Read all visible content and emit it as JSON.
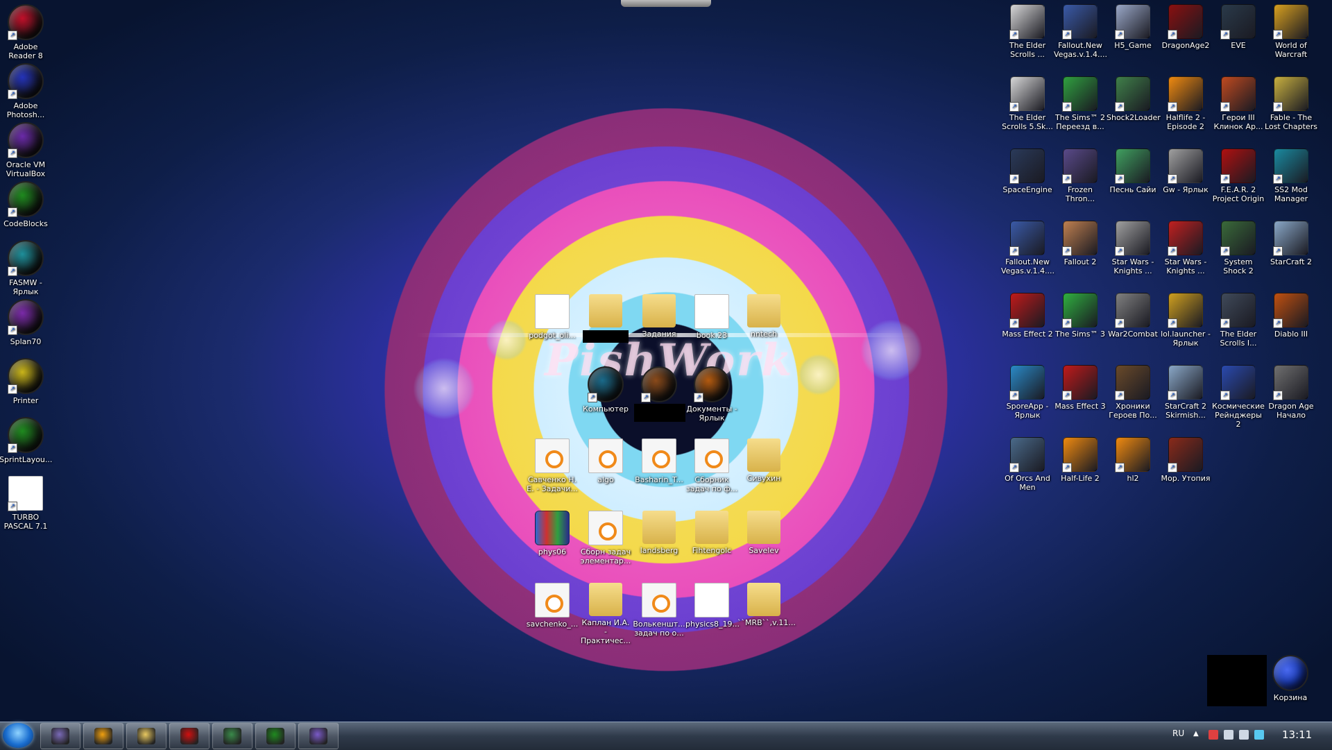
{
  "desktop": {
    "wallpaper_text": "PishWork",
    "left_column": [
      {
        "label": "Adobe Reader 8",
        "icon": "adobe-reader-orb-icon",
        "color": "#c0102a"
      },
      {
        "label": "Adobe Photosh...",
        "icon": "photoshop-orb-icon",
        "color": "#2433b8"
      },
      {
        "label": "Oracle VM VirtualBox",
        "icon": "virtualbox-orb-icon",
        "color": "#6a2aa8"
      },
      {
        "label": "CodeBlocks",
        "icon": "codeblocks-orb-icon",
        "color": "#1f8a1f"
      },
      {
        "label": "FASMW - Ярлык",
        "icon": "fasmw-orb-icon",
        "color": "#1e8f9a"
      },
      {
        "label": "Splan70",
        "icon": "splan-orb-icon",
        "color": "#7a2aa8"
      },
      {
        "label": "Printer",
        "icon": "printer-orb-icon",
        "color": "#c9b51a"
      },
      {
        "label": "SprintLayou...",
        "icon": "sprintlayout-orb-icon",
        "color": "#1f8a1f"
      },
      {
        "label": "TURBO PASCAL 7.1",
        "icon": "turbo-pascal-file-icon",
        "color": "#ffffff"
      }
    ],
    "center_icons": [
      {
        "label": "podgot_oli...",
        "type": "doc"
      },
      {
        "label": "",
        "type": "folder"
      },
      {
        "label": "Задания",
        "type": "folder"
      },
      {
        "label": "book.23",
        "type": "doc"
      },
      {
        "label": "nntech",
        "type": "folder"
      },
      {
        "label": "Компьютер",
        "type": "orb",
        "color": "#1a6a8a"
      },
      {
        "label": "",
        "type": "orb",
        "color": "#8a4a1a"
      },
      {
        "label": "Документы - Ярлык",
        "type": "orb",
        "color": "#b35a10"
      },
      {
        "label": "Савченко Н. Е. - Задачи...",
        "type": "djvu"
      },
      {
        "label": "algo",
        "type": "djvu"
      },
      {
        "label": "Basharin_T...",
        "type": "djvu"
      },
      {
        "label": "Сборник задач по ф...",
        "type": "djvu"
      },
      {
        "label": "Сивухин",
        "type": "folder"
      },
      {
        "label": "phys06",
        "type": "rar"
      },
      {
        "label": "Сборн задач элементар...",
        "type": "djvu"
      },
      {
        "label": "landsberg",
        "type": "folder"
      },
      {
        "label": "Fihtengolc",
        "type": "folder"
      },
      {
        "label": "Savelev",
        "type": "folder"
      },
      {
        "label": "savchenko_...",
        "type": "djvu"
      },
      {
        "label": "Каплан И.А. - Практичес...",
        "type": "folder"
      },
      {
        "label": "Волькеншт... задач по о...",
        "type": "djvu"
      },
      {
        "label": "physics8_19...",
        "type": "doc"
      },
      {
        "label": "``MRB``,v.11...",
        "type": "folder"
      }
    ],
    "right_grid": [
      {
        "label": "The Elder Scrolls ...",
        "color": "#d8d8d8"
      },
      {
        "label": "Fallout.New Vegas.v.1.4....",
        "color": "#3a5aa8"
      },
      {
        "label": "H5_Game",
        "color": "#9aa8c8"
      },
      {
        "label": "DragonAge2",
        "color": "#8a1010"
      },
      {
        "label": "EVE",
        "color": "#2a3a4a"
      },
      {
        "label": "World of Warcraft",
        "color": "#d8a020"
      },
      {
        "label": "The Elder Scrolls 5.Sk...",
        "color": "#d8d8d8"
      },
      {
        "label": "The Sims™ 2 Переезд в...",
        "color": "#30a040"
      },
      {
        "label": "Shock2Loader",
        "color": "#40804a"
      },
      {
        "label": "Halflife 2 - Episode 2",
        "color": "#f08a10"
      },
      {
        "label": "Герои III Клинок Ар...",
        "color": "#c04a20"
      },
      {
        "label": "Fable - The Lost Chapters",
        "color": "#c8b040"
      },
      {
        "label": "SpaceEngine",
        "color": "#2a3a5a"
      },
      {
        "label": "Frozen Thron...",
        "color": "#5a4a8a"
      },
      {
        "label": "Песнь Сайи",
        "color": "#40a060"
      },
      {
        "label": "Gw - Ярлык",
        "color": "#a0a0a0"
      },
      {
        "label": "F.E.A.R. 2 Project Origin",
        "color": "#b01010"
      },
      {
        "label": "SS2 Mod Manager",
        "color": "#1a8aa0"
      },
      {
        "label": "Fallout.New Vegas.v.1.4....",
        "color": "#3a5aa8"
      },
      {
        "label": "Fallout 2",
        "color": "#c08050"
      },
      {
        "label": "Star Wars - Knights ...",
        "color": "#a0a0a0"
      },
      {
        "label": "Star Wars - Knights ...",
        "color": "#c02020"
      },
      {
        "label": "System Shock 2",
        "color": "#3a6a3a"
      },
      {
        "label": "StarCraft 2",
        "color": "#8aa8c8"
      },
      {
        "label": "Mass Effect 2",
        "color": "#c01a1a"
      },
      {
        "label": "The Sims™ 3",
        "color": "#30b040"
      },
      {
        "label": "War2Combat",
        "color": "#808080"
      },
      {
        "label": "lol.launcher - Ярлык",
        "color": "#d0a020"
      },
      {
        "label": "The Elder Scrolls I...",
        "color": "#404a5a"
      },
      {
        "label": "Diablo III",
        "color": "#c05010"
      },
      {
        "label": "SporeApp - Ярлык",
        "color": "#2a8ac8"
      },
      {
        "label": "Mass Effect 3",
        "color": "#c01a1a"
      },
      {
        "label": "Хроники Героев По...",
        "color": "#6a4a2a"
      },
      {
        "label": "StarCraft 2 Skirmish...",
        "color": "#8aa8c8"
      },
      {
        "label": "Космические Рейнджеры 2",
        "color": "#2a4ab0"
      },
      {
        "label": "Dragon Age Начало",
        "color": "#707070"
      },
      {
        "label": "Of Orcs And Men",
        "color": "#4a6a8a"
      },
      {
        "label": "Half-Life 2",
        "color": "#f08a10"
      },
      {
        "label": "hl2",
        "color": "#f08a10"
      },
      {
        "label": "Мор. Утопия",
        "color": "#8a2a1a"
      }
    ],
    "recycle_bin": {
      "label": "Корзина",
      "color": "#1a3ab0"
    }
  },
  "taskbar": {
    "buttons": [
      {
        "name": "pidgin-app",
        "color": "#7a6ab8"
      },
      {
        "name": "aimp-app",
        "color": "#f0a010"
      },
      {
        "name": "explorer-app",
        "color": "#e8c860"
      },
      {
        "name": "opera-app",
        "color": "#d01010"
      },
      {
        "name": "task-manager-app",
        "color": "#3a8a4a"
      },
      {
        "name": "orb-app",
        "color": "#1f8a1f"
      },
      {
        "name": "djvu-viewer-app",
        "color": "#7a5ac8"
      }
    ],
    "language": "RU",
    "clock": "13:11"
  }
}
